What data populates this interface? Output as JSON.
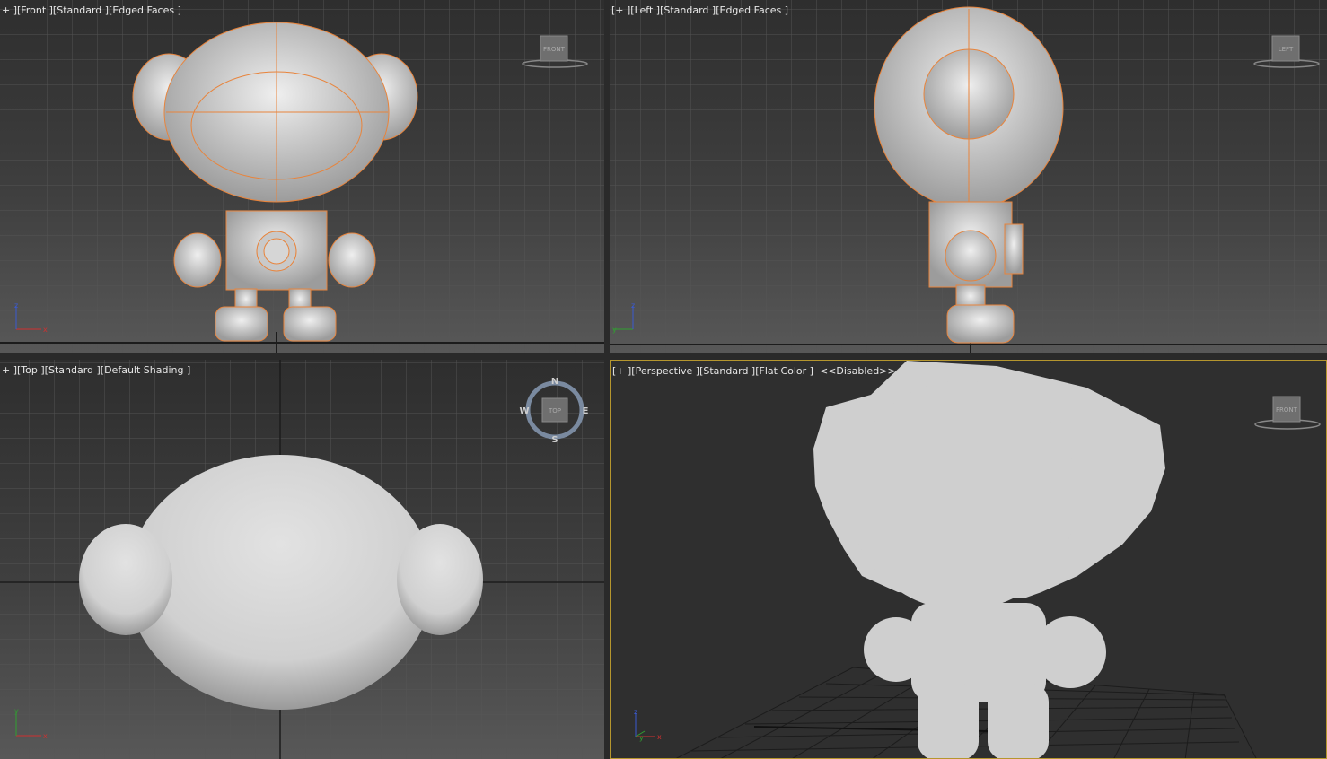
{
  "viewports": {
    "front": {
      "menu": "+ ]",
      "view": "[Front ]",
      "shading": "[Standard ]",
      "mode": "[Edged Faces ]",
      "viewcube_label": "FRONT",
      "axis_x": "x",
      "axis_z": "z"
    },
    "left": {
      "menu": "[+ ]",
      "view": "[Left ]",
      "shading": "[Standard ]",
      "mode": "[Edged Faces ]",
      "viewcube_label": "LEFT",
      "axis_y": "y",
      "axis_z": "z"
    },
    "top": {
      "menu": "+ ]",
      "view": "[Top ]",
      "shading": "[Standard ]",
      "mode": "[Default Shading ]",
      "viewcube_label": "TOP",
      "compass": {
        "n": "N",
        "s": "S",
        "e": "E",
        "w": "W"
      },
      "axis_x": "x",
      "axis_y": "y"
    },
    "perspective": {
      "menu": "[+ ]",
      "view": "[Perspective ]",
      "shading": "[Standard ]",
      "mode": "[Flat Color ]",
      "status": "<<Disabled>>",
      "viewcube_label": "FRONT",
      "axis_x": "x",
      "axis_y": "y",
      "axis_z": "z"
    }
  },
  "colors": {
    "wire": "#e8843c",
    "model": "#d9d9d9",
    "grid": "#5c5c5c",
    "active_border": "#b5962e"
  }
}
